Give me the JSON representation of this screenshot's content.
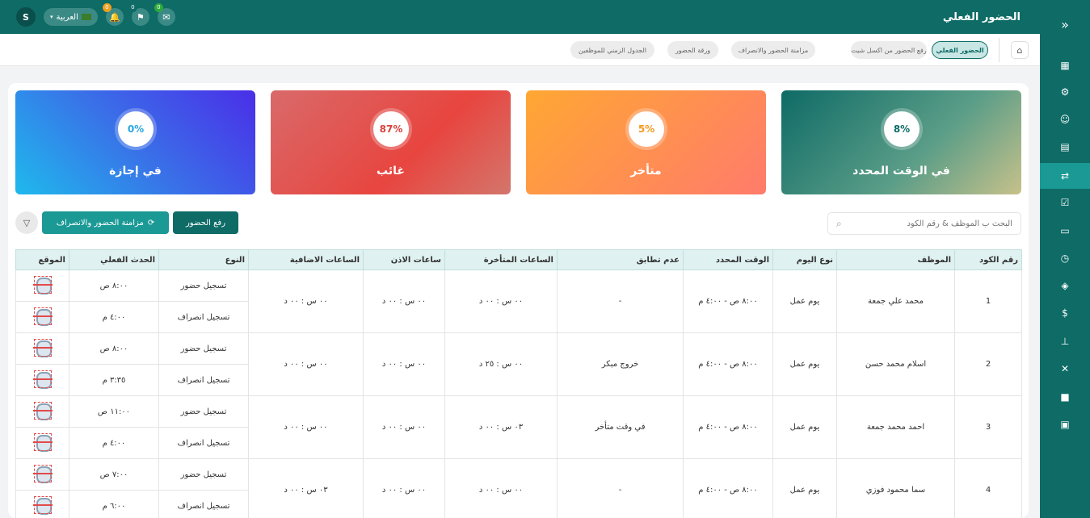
{
  "topbar": {
    "title": "الحضور الفعلي",
    "user_initial": "S",
    "language": "العربية",
    "badges": {
      "notifications": "0",
      "flags": "0",
      "messages": "0"
    }
  },
  "breadcrumbs": [
    "الحضور الفعلي",
    "رفع الحضور من اكسل شيت",
    "مزامنة الحضور والانصراف",
    "ورقة الحضور",
    "الجدول الزمني للموظفين"
  ],
  "cards": [
    {
      "label": "في الوقت المحدد",
      "percent": "8%"
    },
    {
      "label": "متأخر",
      "percent": "5%"
    },
    {
      "label": "غائب",
      "percent": "87%"
    },
    {
      "label": "في إجازة",
      "percent": "0%"
    }
  ],
  "search": {
    "placeholder": "البحث ب الموظف & رقم الكود"
  },
  "buttons": {
    "upload": "رفع الحضور",
    "sync": "مزامنة الحضور والانصراف"
  },
  "table": {
    "headers": [
      "رقم الكود",
      "الموظف",
      "نوع اليوم",
      "الوقت المحدد",
      "عدم تطابق",
      "الساعات المتأخرة",
      "ساعات الاذن",
      "الساعات الاضافية",
      "النوع",
      "الحدث الفعلي",
      "الموقع"
    ],
    "rows": [
      {
        "code": "1",
        "name": "محمد علي جمعة",
        "day": "يوم عمل",
        "scheduled": "٨:٠٠ ص - ٤:٠٠ م",
        "mismatch": "-",
        "late": "٠٠ س : ٠٠ د",
        "permission": "٠٠ س : ٠٠ د",
        "overtime": "٠٠ س : ٠٠ د",
        "events": [
          {
            "type": "تسجيل حضور",
            "time": "٨:٠٠ ص"
          },
          {
            "type": "تسجيل انصراف",
            "time": "٤:٠٠ م"
          }
        ]
      },
      {
        "code": "2",
        "name": "اسلام محمد حسن",
        "day": "يوم عمل",
        "scheduled": "٨:٠٠ ص - ٤:٠٠ م",
        "mismatch": "خروج مبكر",
        "late": "٠٠ س : ٢٥ د",
        "permission": "٠٠ س : ٠٠ د",
        "overtime": "٠٠ س : ٠٠ د",
        "events": [
          {
            "type": "تسجيل حضور",
            "time": "٨:٠٠ ص"
          },
          {
            "type": "تسجيل انصراف",
            "time": "٣:٣٥ م"
          }
        ]
      },
      {
        "code": "3",
        "name": "احمد محمد جمعة",
        "day": "يوم عمل",
        "scheduled": "٨:٠٠ ص - ٤:٠٠ م",
        "mismatch": "في وقت متأخر",
        "late": "٠٣ س : ٠٠ د",
        "permission": "٠٠ س : ٠٠ د",
        "overtime": "٠٠ س : ٠٠ د",
        "events": [
          {
            "type": "تسجيل حضور",
            "time": "١١:٠٠ ص"
          },
          {
            "type": "تسجيل انصراف",
            "time": "٤:٠٠ م"
          }
        ]
      },
      {
        "code": "4",
        "name": "سما محمود فوزي",
        "day": "يوم عمل",
        "scheduled": "٨:٠٠ ص - ٤:٠٠ م",
        "mismatch": "-",
        "late": "٠٠ س : ٠٠ د",
        "permission": "٠٠ س : ٠٠ د",
        "overtime": "٠٣ س : ٠٠ د",
        "events": [
          {
            "type": "تسجيل حضور",
            "time": "٧:٠٠ ص"
          },
          {
            "type": "تسجيل انصراف",
            "time": "٦:٠٠ م"
          }
        ]
      }
    ]
  },
  "sidebar_icons": [
    "collapse-icon",
    "dashboard-icon",
    "settings-icon",
    "user-icon",
    "calendar-icon",
    "attendance-icon",
    "schedule-icon",
    "id-card-icon",
    "clock-icon",
    "layers-icon",
    "payroll-icon",
    "org-chart-icon",
    "user-x-icon",
    "briefcase-icon",
    "document-icon"
  ],
  "colors": {
    "primary": "#0e6b66",
    "active": "#1a9995"
  }
}
